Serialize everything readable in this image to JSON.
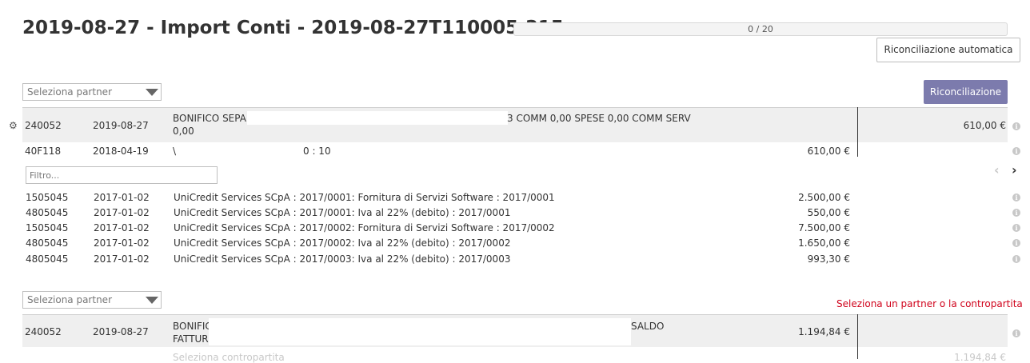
{
  "header": {
    "title": "2019-08-27 - Import Conti - 2019-08-27T110005.315",
    "progress_text": "0 / 20",
    "progress_fraction": 0,
    "auto_reconcile_label": "Riconciliazione automatica"
  },
  "line1": {
    "partner_placeholder": "Seleziona partner",
    "reconcile_label": "Riconciliazione",
    "statement": {
      "account": "240052",
      "date": "2019-08-27",
      "desc_a": "BONIFICO SEPA",
      "desc_b": "3 COMM 0,00 SPESE 0,00 COMM SERV",
      "desc_c": "0,00",
      "amount": "610,00 €"
    },
    "proposed": {
      "account": "40F118",
      "date": "2018-04-19",
      "desc_a": "\\",
      "desc_b": "0 : 10",
      "amount": "610,00 €"
    },
    "filter_placeholder": "Filtro...",
    "pager": {
      "prev": "‹",
      "next": "›"
    },
    "moves": [
      {
        "account": "1505045",
        "date": "2017-01-02",
        "desc": "UniCredit Services SCpA : 2017/0001: Fornitura di Servizi Software : 2017/0001",
        "amount": "2.500,00 €"
      },
      {
        "account": "4805045",
        "date": "2017-01-02",
        "desc": "UniCredit Services SCpA : 2017/0001: Iva al 22% (debito) : 2017/0001",
        "amount": "550,00 €"
      },
      {
        "account": "1505045",
        "date": "2017-01-02",
        "desc": "UniCredit Services SCpA : 2017/0002: Fornitura di Servizi Software : 2017/0002",
        "amount": "7.500,00 €"
      },
      {
        "account": "4805045",
        "date": "2017-01-02",
        "desc": "UniCredit Services SCpA : 2017/0002: Iva al 22% (debito) : 2017/0002",
        "amount": "1.650,00 €"
      },
      {
        "account": "4805045",
        "date": "2017-01-02",
        "desc": "UniCredit Services SCpA : 2017/0003: Iva al 22% (debito) : 2017/0003",
        "amount": "993,30 €"
      }
    ]
  },
  "line2": {
    "partner_placeholder": "Seleziona partner",
    "warning": "Seleziona un partner o la contropartita",
    "statement": {
      "account": "240052",
      "date": "2019-08-27",
      "desc_a": "BONIFIC",
      "desc_b": "SALDO",
      "desc_c": "FATTUR",
      "amount": "1.194,84 €"
    },
    "counterpart_placeholder": "Seleziona contropartita",
    "counterpart_amount": "1.194,84 €"
  },
  "icons": {
    "info": "info-icon",
    "gear": "gear-icon",
    "chevron_left": "chevron-left-icon",
    "chevron_right": "chevron-right-icon",
    "caret": "caret-down-icon"
  }
}
